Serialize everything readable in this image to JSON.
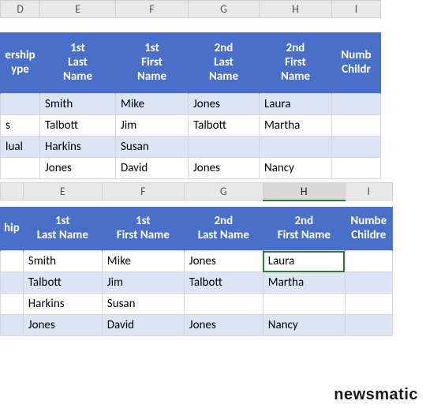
{
  "watermark": "newsmatic",
  "columns": {
    "D": "D",
    "E": "E",
    "F": "F",
    "G": "G",
    "H": "H",
    "I": "I"
  },
  "sheet1": {
    "headers": {
      "D": {
        "l1": "",
        "l2": "ership",
        "l3": "ype"
      },
      "E": {
        "l1": "1st",
        "l2": "Last",
        "l3": "Name"
      },
      "F": {
        "l1": "1st",
        "l2": "First",
        "l3": "Name"
      },
      "G": {
        "l1": "2nd",
        "l2": "Last",
        "l3": "Name"
      },
      "H": {
        "l1": "2nd",
        "l2": "First",
        "l3": "Name"
      },
      "I": {
        "l1": "",
        "l2": "Numb",
        "l3": "Childr"
      }
    },
    "rows": [
      {
        "D": "",
        "E": "Smith",
        "F": "Mike",
        "G": "Jones",
        "H": "Laura",
        "I": ""
      },
      {
        "D": "s",
        "E": "Talbott",
        "F": "Jim",
        "G": "Talbott",
        "H": "Martha",
        "I": ""
      },
      {
        "D": "lual",
        "E": "Harkins",
        "F": "Susan",
        "G": "",
        "H": "",
        "I": ""
      },
      {
        "D": "",
        "E": "Jones",
        "F": "David",
        "G": "Jones",
        "H": "Nancy",
        "I": ""
      }
    ]
  },
  "sheet2": {
    "headers": {
      "D": {
        "l1": "hip",
        "l2": ""
      },
      "E": {
        "l1": "1st",
        "l2": "Last Name"
      },
      "F": {
        "l1": "1st",
        "l2": "First Name"
      },
      "G": {
        "l1": "2nd",
        "l2": "Last Name"
      },
      "H": {
        "l1": "2nd",
        "l2": "First Name"
      },
      "I": {
        "l1": "Numbe",
        "l2": "Childre"
      }
    },
    "rows": [
      {
        "D": "",
        "E": "Smith",
        "F": "Mike",
        "G": "Jones",
        "H": "Laura",
        "I": ""
      },
      {
        "D": "",
        "E": "Talbott",
        "F": "Jim",
        "G": "Talbott",
        "H": "Martha",
        "I": ""
      },
      {
        "D": "",
        "E": "Harkins",
        "F": "Susan",
        "G": "",
        "H": "",
        "I": ""
      },
      {
        "D": "",
        "E": "Jones",
        "F": "David",
        "G": "Jones",
        "H": "Nancy",
        "I": ""
      }
    ]
  }
}
